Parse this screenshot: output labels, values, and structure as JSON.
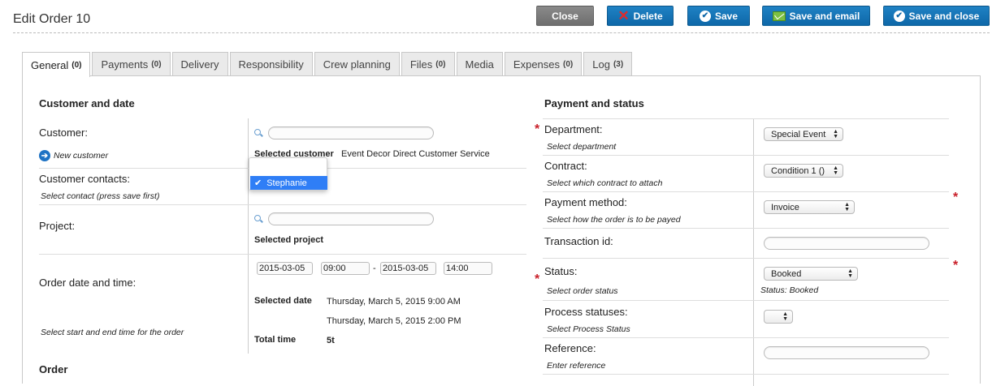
{
  "header": {
    "title": "Edit Order 10",
    "buttons": {
      "close": "Close",
      "delete": "Delete",
      "save": "Save",
      "save_email": "Save and email",
      "save_close": "Save and close"
    }
  },
  "tabs": [
    {
      "label": "General",
      "count": "(0)"
    },
    {
      "label": "Payments",
      "count": "(0)"
    },
    {
      "label": "Delivery",
      "count": ""
    },
    {
      "label": "Responsibility",
      "count": ""
    },
    {
      "label": "Crew planning",
      "count": ""
    },
    {
      "label": "Files",
      "count": "(0)"
    },
    {
      "label": "Media",
      "count": ""
    },
    {
      "label": "Expenses",
      "count": "(0)"
    },
    {
      "label": "Log",
      "count": "(3)"
    }
  ],
  "left": {
    "section_title": "Customer and date",
    "customer_label": "Customer:",
    "new_customer": "New customer",
    "customer_search": "",
    "selected_customer_label": "Selected customer",
    "selected_customer_value": "Event Decor Direct Customer Service",
    "contacts_label": "Customer contacts:",
    "contacts_hint": "Select contact (press save first)",
    "contact_dropdown_selected": "Stephanie",
    "project_label": "Project:",
    "project_search": "",
    "selected_project_label": "Selected project",
    "order_date_label": "Order date and time:",
    "order_date_hint": "Select start and end time for the order",
    "start_date": "2015-03-05",
    "start_time": "09:00",
    "date_sep": "-",
    "end_date": "2015-03-05",
    "end_time": "14:00",
    "selected_date_label": "Selected date",
    "selected_date_start": "Thursday, March 5, 2015 9:00 AM",
    "selected_date_end": "Thursday, March 5, 2015 2:00 PM",
    "total_time_label": "Total time",
    "total_time_value": "5t",
    "order_section_title": "Order"
  },
  "right": {
    "section_title": "Payment and status",
    "department_label": "Department:",
    "department_hint": "Select department",
    "department_value": "Special Event",
    "contract_label": "Contract:",
    "contract_hint": "Select which contract to attach",
    "contract_value": "Condition 1 ()",
    "payment_method_label": "Payment method:",
    "payment_method_hint": "Select how the order is to be payed",
    "payment_method_value": "Invoice",
    "transaction_label": "Transaction id:",
    "transaction_value": "",
    "status_label": "Status:",
    "status_hint": "Select order status",
    "status_value": "Booked",
    "status_note": "Status: Booked",
    "process_label": "Process statuses:",
    "process_hint": "Select Process Status",
    "process_value": "",
    "reference_label": "Reference:",
    "reference_hint": "Enter reference",
    "reference_value": ""
  },
  "required_mark": "*"
}
